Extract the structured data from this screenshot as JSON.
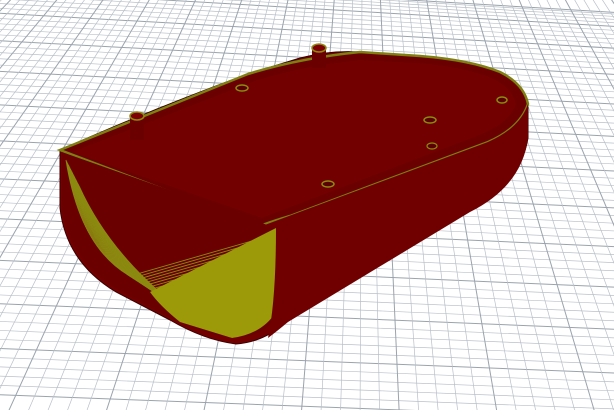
{
  "viewport": {
    "background_color": "#ffffff",
    "grid_color": "#b9c0c8",
    "grid_major_color": "#9aa3ad"
  },
  "model": {
    "shell_color": "#730000",
    "shell_dark_color": "#5a0000",
    "layer_line_color": "#8c8a10",
    "infill_color": "#9c9a08",
    "rim_color": "#7f7f12"
  }
}
